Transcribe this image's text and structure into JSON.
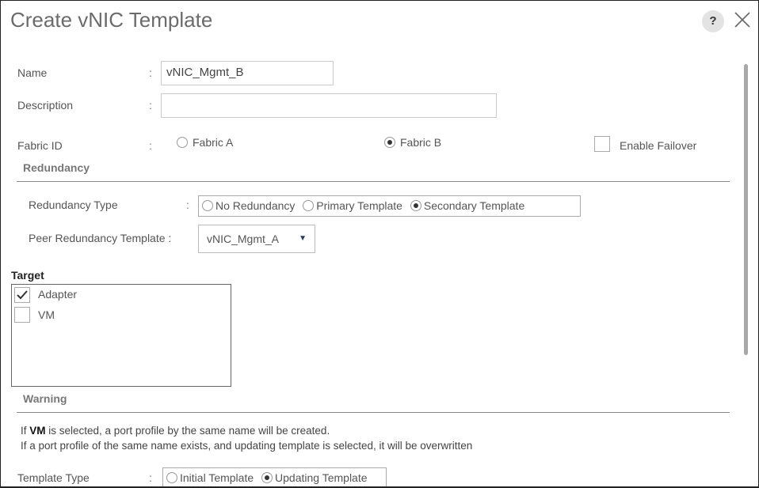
{
  "dialog": {
    "title": "Create vNIC Template",
    "help_label": "?",
    "close_icon": "close-icon"
  },
  "form": {
    "name": {
      "label": "Name",
      "colon": ":",
      "value": "vNIC_Mgmt_B"
    },
    "description": {
      "label": "Description",
      "colon": ":",
      "value": ""
    },
    "fabric_id": {
      "label": "Fabric ID",
      "colon": ":",
      "options": [
        {
          "label": "Fabric A",
          "selected": false
        },
        {
          "label": "Fabric B",
          "selected": true
        }
      ],
      "enable_failover": {
        "label": "Enable Failover",
        "checked": false
      }
    }
  },
  "redundancy": {
    "heading": "Redundancy",
    "type": {
      "label": "Redundancy Type",
      "colon": ":",
      "options": [
        {
          "label": "No Redundancy",
          "selected": false
        },
        {
          "label": "Primary Template",
          "selected": false
        },
        {
          "label": "Secondary Template",
          "selected": true
        }
      ]
    },
    "peer": {
      "label": "Peer Redundancy Template :",
      "selected": "vNIC_Mgmt_A",
      "arrow": "▼"
    }
  },
  "target": {
    "heading": "Target",
    "items": [
      {
        "label": "Adapter",
        "checked": true,
        "check_glyph": "✓"
      },
      {
        "label": "VM",
        "checked": false,
        "check_glyph": ""
      }
    ]
  },
  "warning": {
    "heading": "Warning",
    "line1_prefix": "If ",
    "line1_bold": "VM",
    "line1_suffix": " is selected, a port profile by the same name will be created.",
    "line2": "If a port profile of the same name exists, and updating template is selected, it will be overwritten"
  },
  "template_type": {
    "label": "Template Type",
    "colon": ":",
    "options": [
      {
        "label": "Initial Template",
        "selected": false
      },
      {
        "label": "Updating Template",
        "selected": true
      }
    ]
  }
}
